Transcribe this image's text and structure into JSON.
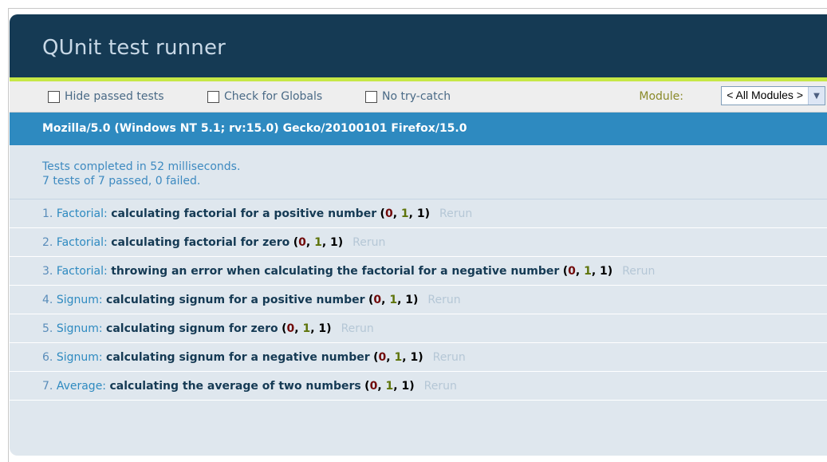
{
  "header": {
    "title": "QUnit test runner"
  },
  "toolbar": {
    "hide_passed_label": "Hide passed tests",
    "check_globals_label": "Check for Globals",
    "no_try_catch_label": "No try-catch",
    "module_label": "Module:",
    "module_selected": "< All Modules >"
  },
  "user_agent": "Mozilla/5.0 (Windows NT 5.1; rv:15.0) Gecko/20100101 Firefox/15.0",
  "summary": {
    "line1": "Tests completed in 52 milliseconds.",
    "line2": "7 tests of 7 passed, 0 failed."
  },
  "tests": [
    {
      "num": "1.",
      "module": "Factorial:",
      "name": "calculating factorial for a positive number",
      "failed": "0",
      "passed": "1",
      "total": "1",
      "rerun": "Rerun"
    },
    {
      "num": "2.",
      "module": "Factorial:",
      "name": "calculating factorial for zero",
      "failed": "0",
      "passed": "1",
      "total": "1",
      "rerun": "Rerun"
    },
    {
      "num": "3.",
      "module": "Factorial:",
      "name": "throwing an error when calculating the factorial for a negative number",
      "failed": "0",
      "passed": "1",
      "total": "1",
      "rerun": "Rerun"
    },
    {
      "num": "4.",
      "module": "Signum:",
      "name": "calculating signum for a positive number",
      "failed": "0",
      "passed": "1",
      "total": "1",
      "rerun": "Rerun"
    },
    {
      "num": "5.",
      "module": "Signum:",
      "name": "calculating signum for zero",
      "failed": "0",
      "passed": "1",
      "total": "1",
      "rerun": "Rerun"
    },
    {
      "num": "6.",
      "module": "Signum:",
      "name": "calculating signum for a negative number",
      "failed": "0",
      "passed": "1",
      "total": "1",
      "rerun": "Rerun"
    },
    {
      "num": "7.",
      "module": "Average:",
      "name": "calculating the average of two numbers",
      "failed": "0",
      "passed": "1",
      "total": "1",
      "rerun": "Rerun"
    }
  ],
  "colors": {
    "header_bg": "#153a54",
    "banner_stripe": "#c6e746",
    "useragent_bg": "#2e8ac0",
    "body_bg": "#dfe7ee",
    "failed_color": "#710909",
    "passed_color": "#5e740b"
  }
}
